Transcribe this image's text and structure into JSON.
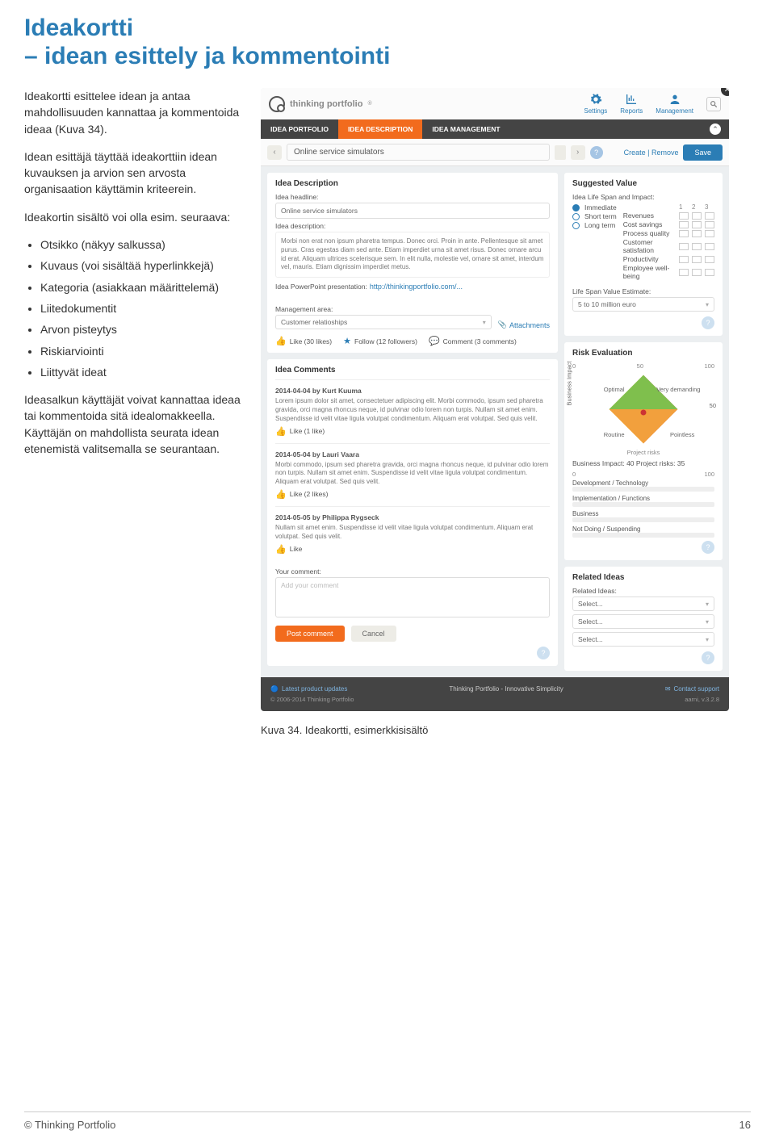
{
  "doc": {
    "title_l1": "Ideakortti",
    "title_l2": "– idean esittely ja kommentointi",
    "p1": "Ideakortti esittelee idean ja antaa mahdollisuuden kannattaa ja kommentoida ideaa (Kuva 34).",
    "p2": "Idean esittäjä täyttää ideakorttiin idean kuvauksen ja arvion sen arvosta organisaation käyttämin kriteerein.",
    "p3": "Ideakortin sisältö voi olla esim. seuraava:",
    "bullets": [
      "Otsikko (näkyy salkussa)",
      "Kuvaus (voi sisältää hyperlinkkejä)",
      "Kategoria (asiakkaan määrittelemä)",
      "Liitedokumentit",
      "Arvon pisteytys",
      "Riskiarviointi",
      "Liittyvät ideat"
    ],
    "p4": "Ideasalkun käyttäjät voivat kannattaa ideaa tai kommentoida sitä idealomakkeella. Käyttäjän on mahdollista seurata idean etenemistä valitsemalla se seurantaan.",
    "caption": "Kuva 34. Ideakortti, esimerkkisisältö",
    "footer_left": "© Thinking Portfolio",
    "footer_right": "16"
  },
  "app": {
    "brand": "thinking portfolio",
    "header_icons": [
      "Settings",
      "Reports",
      "Management"
    ],
    "tabs": [
      "IDEA PORTFOLIO",
      "IDEA DESCRIPTION",
      "IDEA MANAGEMENT"
    ],
    "active_tab": 1,
    "title_value": "Online service simulators",
    "create_remove": "Create | Remove",
    "save": "Save",
    "desc": {
      "heading": "Idea Description",
      "headline_lbl": "Idea headline:",
      "headline_val": "Online service simulators",
      "desc_lbl": "Idea description:",
      "desc_txt": "Morbi non erat non ipsum pharetra tempus. Donec orci. Proin in ante. Pellentesque sit amet purus. Cras egestas diam sed ante. Etiam imperdiet urna sit amet risus. Donec ornare arcu id erat. Aliquam ultrices scelerisque sem. In elit nulla, molestie vel, ornare sit amet, interdum vel, mauris. Etiam dignissim imperdiet metus.",
      "ppt_lbl": "Idea PowerPoint presentation:",
      "ppt_link": "http://thinkingportfolio.com/...",
      "mgmt_lbl": "Management area:",
      "mgmt_val": "Customer relatioships",
      "attachments": "Attachments",
      "like": "Like (30 likes)",
      "follow": "Follow (12 followers)",
      "comment": "Comment (3 comments)"
    },
    "comments": {
      "heading": "Idea Comments",
      "items": [
        {
          "meta": "2014-04-04 by Kurt Kuuma",
          "body": "Lorem ipsum dolor sit amet, consectetuer adipiscing elit. Morbi commodo, ipsum sed pharetra gravida, orci magna rhoncus neque, id pulvinar odio lorem non turpis. Nullam sit amet enim. Suspendisse id velit vitae ligula volutpat condimentum. Aliquam erat volutpat. Sed quis velit.",
          "like": "Like (1 like)"
        },
        {
          "meta": "2014-05-04 by Lauri Vaara",
          "body": "Morbi commodo, ipsum sed pharetra gravida, orci magna rhoncus neque, id pulvinar odio lorem non turpis. Nullam sit amet enim. Suspendisse id velit vitae ligula volutpat condimentum. Aliquam erat volutpat. Sed quis velit.",
          "like": "Like (2 likes)"
        },
        {
          "meta": "2014-05-05 by Philippa Rygseck",
          "body": "Nullam sit amet enim. Suspendisse id velit vitae ligula volutpat condimentum. Aliquam erat volutpat. Sed quis velit.",
          "like": "Like"
        }
      ],
      "your_comment_lbl": "Your comment:",
      "your_comment_ph": "Add your comment",
      "post": "Post comment",
      "cancel": "Cancel"
    },
    "suggested": {
      "heading": "Suggested Value",
      "lifespan_lbl": "Idea Life Span and Impact:",
      "radios": [
        "Immediate",
        "Short term",
        "Long term"
      ],
      "grid_cols": [
        "1",
        "2",
        "3"
      ],
      "grid_rows": [
        "Revenues",
        "Cost savings",
        "Process quality",
        "Customer satisfation",
        "Productivity",
        "Employee well-being"
      ],
      "estimate_lbl": "Life Span Value Estimate:",
      "estimate_val": "5 to 10 million euro"
    },
    "risk": {
      "heading": "Risk Evaluation",
      "quad": [
        "Optimal",
        "Very demanding",
        "Routine",
        "Pointless"
      ],
      "yaxis": "Business Impact",
      "xaxis": "Project risks",
      "scale": [
        "0",
        "50",
        "100"
      ],
      "summary": "Business Impact: 40  Project risks: 35",
      "bars": [
        "Development / Technology",
        "Implementation / Functions",
        "Business",
        "Not Doing / Suspending"
      ]
    },
    "related": {
      "heading": "Related Ideas",
      "lbl": "Related Ideas:",
      "select": "Select..."
    },
    "footer": {
      "updates": "Latest product updates",
      "center": "Thinking Portfolio - Innovative Simplicity",
      "support": "Contact support",
      "copyright": "© 2006-2014 Thinking Portfolio",
      "version": "aarni, v.3.2.8"
    }
  }
}
